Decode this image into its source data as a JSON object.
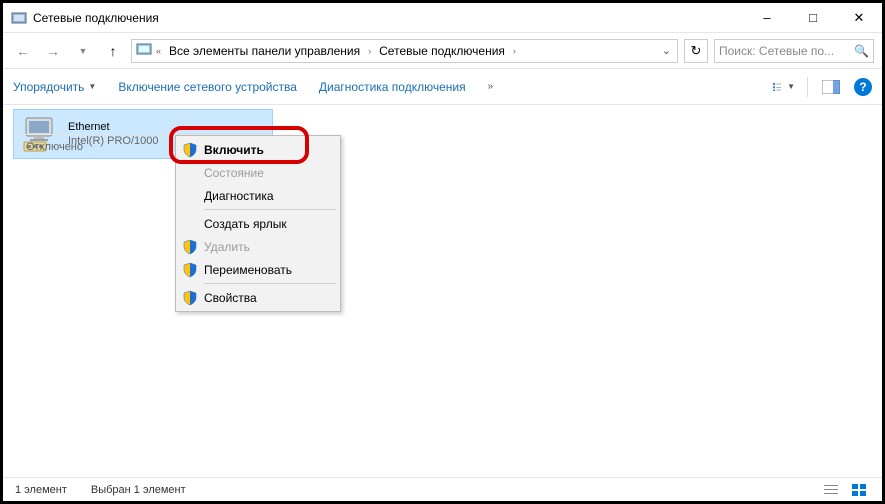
{
  "window": {
    "title": "Сетевые подключения"
  },
  "breadcrumb": {
    "seg1": "Все элементы панели управления",
    "seg2": "Сетевые подключения"
  },
  "search": {
    "placeholder": "Поиск: Сетевые по..."
  },
  "toolbar": {
    "organize": "Упорядочить",
    "enable_device": "Включение сетевого устройства",
    "diagnose": "Диагностика подключения"
  },
  "connection": {
    "name": "Ethernet",
    "status": "Отключено",
    "adapter": "Intel(R) PRO/1000"
  },
  "context_menu": {
    "enable": "Включить",
    "status": "Состояние",
    "diagnose": "Диагностика",
    "shortcut": "Создать ярлык",
    "delete": "Удалить",
    "rename": "Переименовать",
    "properties": "Свойства"
  },
  "statusbar": {
    "count": "1 элемент",
    "selected": "Выбран 1 элемент"
  }
}
